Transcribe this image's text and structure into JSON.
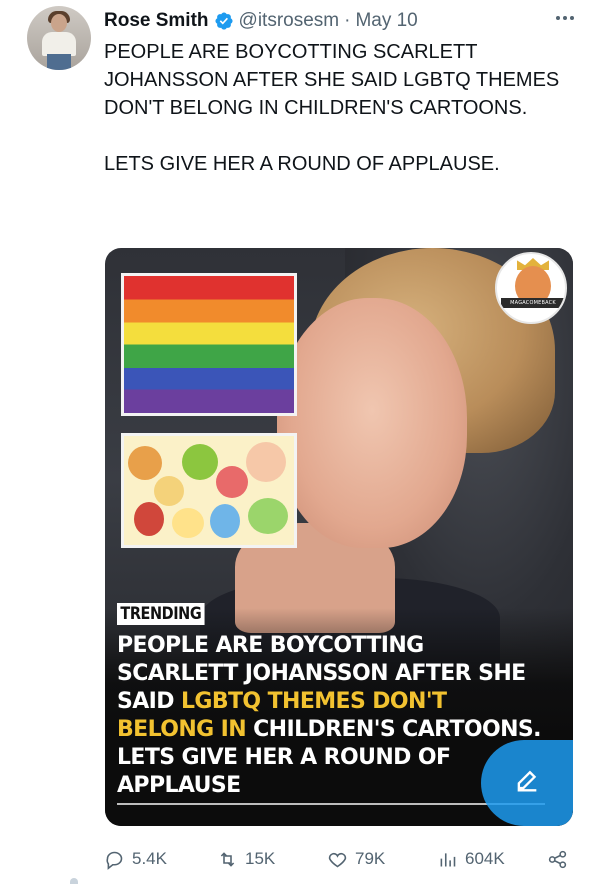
{
  "tweet": {
    "author_name": "Rose Smith",
    "handle": "@itsrosesm",
    "separator": "·",
    "date": "May 10",
    "text_line1": "PEOPLE ARE BOYCOTTING SCARLETT JOHANSSON AFTER SHE SAID LGBTQ THEMES DON'T BELONG IN CHILDREN'S CARTOONS.",
    "text_line2": "LETS GIVE HER A ROUND OF APPLAUSE."
  },
  "media": {
    "badge_label": "TRENDING",
    "logo_text": "MAGACOMEBACK",
    "headline_part1": "PEOPLE ARE BOYCOTTING SCARLETT JOHANSSON AFTER SHE SAID ",
    "headline_highlight": "LGBTQ THEMES DON'T BELONG IN",
    "headline_part2": " CHILDREN'S CARTOONS. LETS GIVE HER A ROUND OF APPLAUSE",
    "highlight_color": "#f2c230"
  },
  "actions": {
    "replies": "5.4K",
    "retweets": "15K",
    "likes": "79K",
    "views": "604K"
  },
  "colors": {
    "accent": "#1d9bf0",
    "secondary_text": "#536471",
    "primary_text": "#0f1419"
  },
  "icons": {
    "verified": "verified-badge-icon",
    "more": "more-horizontal-icon",
    "reply": "reply-icon",
    "retweet": "retweet-icon",
    "like": "heart-icon",
    "views": "views-chart-icon",
    "share": "share-icon",
    "compose": "compose-icon"
  }
}
